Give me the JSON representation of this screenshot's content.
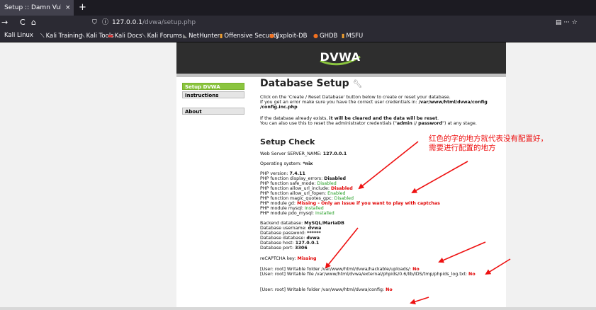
{
  "browser": {
    "tab_title": "Setup :: Damn Vulnerable",
    "tab_close": "×",
    "new_tab": "+",
    "back": "→",
    "reload": "C",
    "home": "⌂",
    "url_host": "127.0.0.1",
    "url_path": "/dvwa/setup.php",
    "right_buttons": "▤  ···  ☆",
    "bookmarks": [
      {
        "label": "Kali Linux",
        "icon": "kali-icon"
      },
      {
        "label": "Kali Training",
        "icon": "kali-icon"
      },
      {
        "label": "Kali Tools",
        "icon": "kali-icon"
      },
      {
        "label": "Kali Docs",
        "icon": "kali-docs-icon"
      },
      {
        "label": "Kali Forums",
        "icon": "kali-icon"
      },
      {
        "label": "NetHunter",
        "icon": "nethunter-icon"
      },
      {
        "label": "Offensive Security",
        "icon": "offsec-icon"
      },
      {
        "label": "Exploit-DB",
        "icon": "exploitdb-icon"
      },
      {
        "label": "GHDB",
        "icon": "exploitdb-icon"
      },
      {
        "label": "MSFU",
        "icon": "offsec-icon"
      }
    ]
  },
  "dvwa": {
    "logo": "DVWA",
    "menu": [
      "Setup DVWA",
      "Instructions",
      "About"
    ],
    "title": "Database Setup",
    "intro1": "Click on the 'Create / Reset Database' button below to create or reset your database.",
    "intro2a": "If you get an error make sure you have the correct user credentials in: ",
    "intro2b": "/var/www/html/dvwa/config",
    "intro3": "/config.inc.php",
    "warn1a": "If the database already exists, ",
    "warn1b": "it will be cleared and the data will be reset",
    "warn1c": ".",
    "warn2a": "You can also use this to reset the administrator credentials (\"",
    "warn2b": "admin",
    "warn2c": " // ",
    "warn2d": "password",
    "warn2e": "\") at any stage.",
    "check_title": "Setup Check",
    "server_label": "Web Server SERVER_NAME: ",
    "server_value": "127.0.0.1",
    "os_label": "Operating system: ",
    "os_value": "*nix",
    "php_version_label": "PHP version: ",
    "php_version_value": "7.4.11",
    "display_errors_label": "PHP function display_errors: ",
    "display_errors_value": "Disabled",
    "safe_mode_label": "PHP function safe_mode: ",
    "safe_mode_value": "Disabled",
    "url_include_label": "PHP function allow_url_include: ",
    "url_include_value": "Disabled",
    "url_fopen_label": "PHP function allow_url_fopen: ",
    "url_fopen_value": "Enabled",
    "magic_quotes_label": "PHP function magic_quotes_gpc: ",
    "magic_quotes_value": "Disabled",
    "gd_label": "PHP module gd: ",
    "gd_value": "Missing - Only an issue if you want to play with captchas",
    "mysql_label": "PHP module mysql: ",
    "mysql_value": "Installed",
    "pdo_label": "PHP module pdo_mysql: ",
    "pdo_value": "Installed",
    "backend_label": "Backend database: ",
    "backend_value": "MySQL/MariaDB",
    "db_user_label": "Database username: ",
    "db_user_value": "dvwa",
    "db_pass_label": "Database password: ",
    "db_pass_value": "******",
    "db_name_label": "Database database: ",
    "db_name_value": "dvwa",
    "db_host_label": "Database host: ",
    "db_host_value": "127.0.0.1",
    "db_port_label": "Database port: ",
    "db_port_value": "3306",
    "recaptcha_label": "reCAPTCHA key: ",
    "recaptcha_value": "Missing",
    "upload_label": "[User: root] Writable folder /var/www/html/dvwa/hackable/uploads/: ",
    "upload_value": "No",
    "phpids_label": "[User: root] Writable file /var/www/html/dvwa/external/phpids/0.6/lib/IDS/tmp/phpids_log.txt: ",
    "phpids_value": "No",
    "config_label": "[User: root] Writable folder /var/www/html/dvwa/config: ",
    "config_value": "No"
  },
  "annotation": {
    "line1": "红色的字的地方就代表没有配置好，",
    "line2": "需要进行配置的地方",
    "color": "#ee1111"
  }
}
